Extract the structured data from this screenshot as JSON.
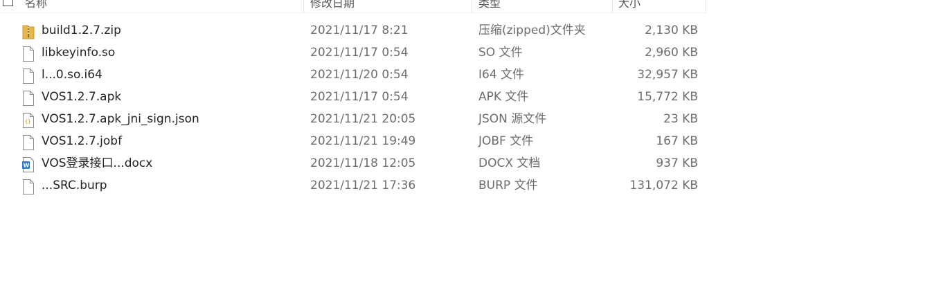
{
  "columns": {
    "name": "名称",
    "date": "修改日期",
    "type": "类型",
    "size": "大小"
  },
  "files": [
    {
      "name": "build1.2.7.zip",
      "date": "2021/11/17 8:21",
      "type": "压缩(zipped)文件夹",
      "size": "2,130 KB",
      "icon": "zip-folder-icon"
    },
    {
      "name": "libkeyinfo.so",
      "date": "2021/11/17 0:54",
      "type": "SO 文件",
      "size": "2,960 KB",
      "icon": "file-icon"
    },
    {
      "name": "l...0.so.i64",
      "date": "2021/11/20 0:54",
      "type": "I64 文件",
      "size": "32,957 KB",
      "icon": "file-icon"
    },
    {
      "name": "VOS1.2.7.apk",
      "date": "2021/11/17 0:54",
      "type": "APK 文件",
      "size": "15,772 KB",
      "icon": "file-icon"
    },
    {
      "name": "VOS1.2.7.apk_jni_sign.json",
      "date": "2021/11/21 20:05",
      "type": "JSON 源文件",
      "size": "23 KB",
      "icon": "json-file-icon"
    },
    {
      "name": "VOS1.2.7.jobf",
      "date": "2021/11/21 19:49",
      "type": "JOBF 文件",
      "size": "167 KB",
      "icon": "file-icon"
    },
    {
      "name": "VOS登录接口...docx",
      "date": "2021/11/18 12:05",
      "type": "DOCX 文档",
      "size": "937 KB",
      "icon": "word-doc-icon"
    },
    {
      "name": "...SRC.burp",
      "date": "2021/11/21 17:36",
      "type": "BURP 文件",
      "size": "131,072 KB",
      "icon": "file-icon"
    }
  ],
  "colors": {
    "zip_folder": "#e8b64a",
    "word_blue": "#2b7cd3"
  }
}
